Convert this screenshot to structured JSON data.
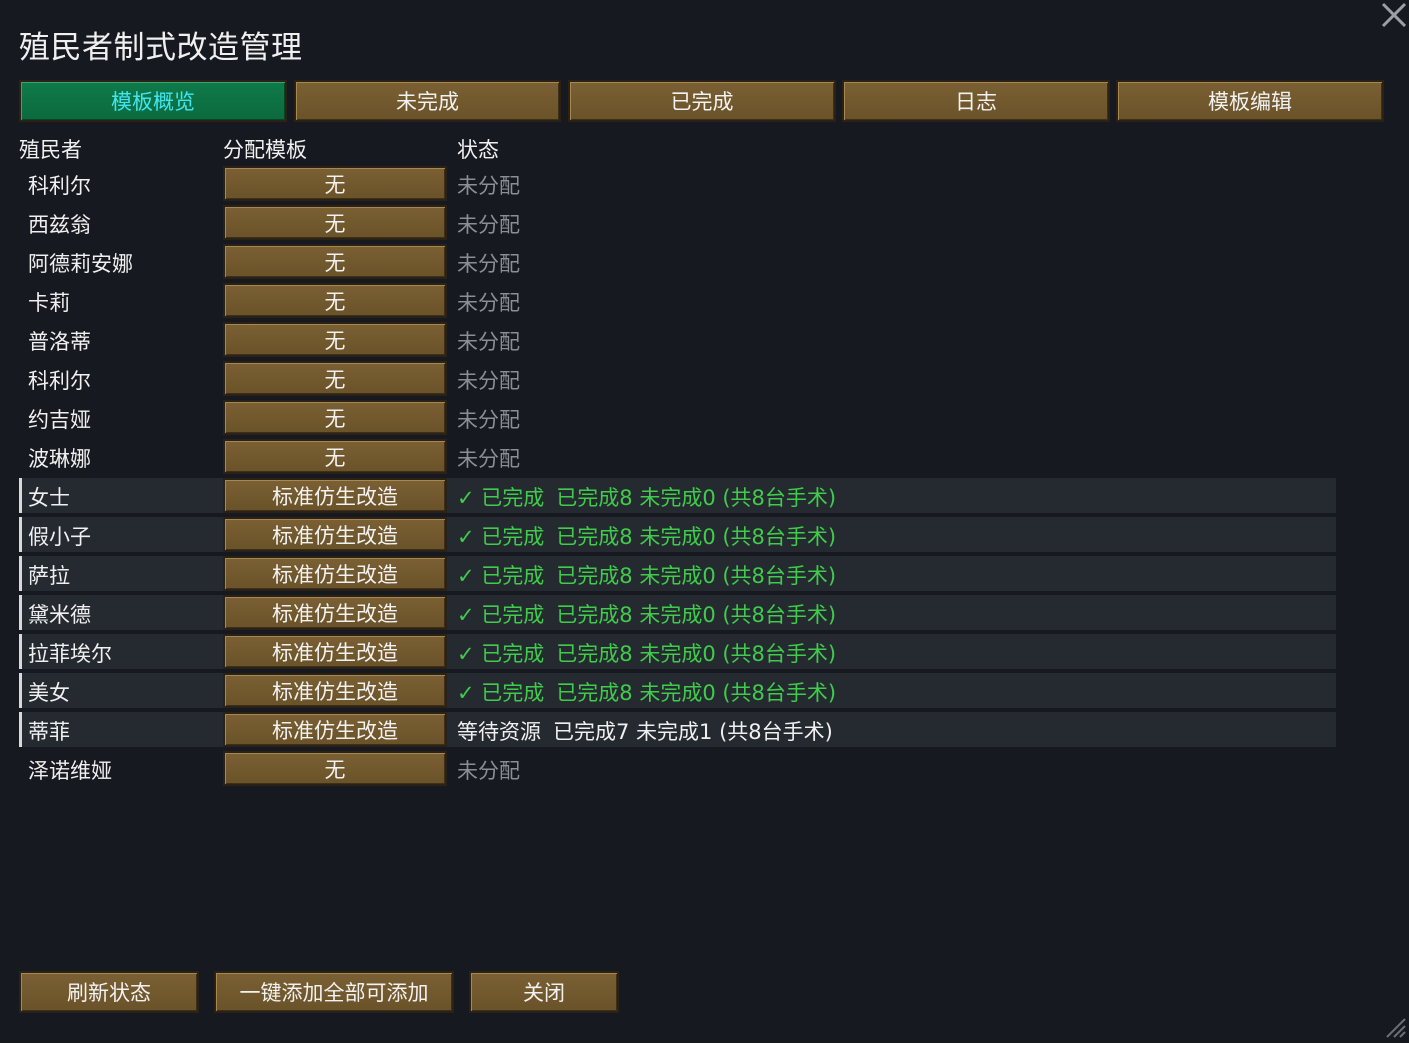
{
  "window": {
    "title": "殖民者制式改造管理"
  },
  "tabs": [
    {
      "label": "模板概览",
      "active": true
    },
    {
      "label": "未完成",
      "active": false
    },
    {
      "label": "已完成",
      "active": false
    },
    {
      "label": "日志",
      "active": false
    },
    {
      "label": "模板编辑",
      "active": false
    }
  ],
  "columns": {
    "colonist": "殖民者",
    "template": "分配模板",
    "status": "状态"
  },
  "rows": [
    {
      "name": "科利尔",
      "template": "无",
      "status": "未分配",
      "detail": "",
      "kind": "unassigned"
    },
    {
      "name": "西兹翁",
      "template": "无",
      "status": "未分配",
      "detail": "",
      "kind": "unassigned"
    },
    {
      "name": "阿德莉安娜",
      "template": "无",
      "status": "未分配",
      "detail": "",
      "kind": "unassigned"
    },
    {
      "name": "卡莉",
      "template": "无",
      "status": "未分配",
      "detail": "",
      "kind": "unassigned"
    },
    {
      "name": "普洛蒂",
      "template": "无",
      "status": "未分配",
      "detail": "",
      "kind": "unassigned"
    },
    {
      "name": "科利尔",
      "template": "无",
      "status": "未分配",
      "detail": "",
      "kind": "unassigned"
    },
    {
      "name": "约吉娅",
      "template": "无",
      "status": "未分配",
      "detail": "",
      "kind": "unassigned"
    },
    {
      "name": "波琳娜",
      "template": "无",
      "status": "未分配",
      "detail": "",
      "kind": "unassigned"
    },
    {
      "name": "女士",
      "template": "标准仿生改造",
      "status": "✓ 已完成",
      "detail": "已完成8 未完成0 (共8台手术)",
      "kind": "done"
    },
    {
      "name": "假小子",
      "template": "标准仿生改造",
      "status": "✓ 已完成",
      "detail": "已完成8 未完成0 (共8台手术)",
      "kind": "done"
    },
    {
      "name": "萨拉",
      "template": "标准仿生改造",
      "status": "✓ 已完成",
      "detail": "已完成8 未完成0 (共8台手术)",
      "kind": "done"
    },
    {
      "name": "黛米德",
      "template": "标准仿生改造",
      "status": "✓ 已完成",
      "detail": "已完成8 未完成0 (共8台手术)",
      "kind": "done"
    },
    {
      "name": "拉菲埃尔",
      "template": "标准仿生改造",
      "status": "✓ 已完成",
      "detail": "已完成8 未完成0 (共8台手术)",
      "kind": "done"
    },
    {
      "name": "美女",
      "template": "标准仿生改造",
      "status": "✓ 已完成",
      "detail": "已完成8 未完成0 (共8台手术)",
      "kind": "done"
    },
    {
      "name": "蒂菲",
      "template": "标准仿生改造",
      "status": "等待资源",
      "detail": "已完成7 未完成1 (共8台手术)",
      "kind": "waiting"
    },
    {
      "name": "泽诺维娅",
      "template": "无",
      "status": "未分配",
      "detail": "",
      "kind": "unassigned"
    }
  ],
  "footer": {
    "refresh_label": "刷新状态",
    "add_all_label": "一键添加全部可添加",
    "close_label": "关闭"
  },
  "colors": {
    "background": "#16191f",
    "button_brown": "#6e552b",
    "tab_active_green": "#0f7a4a",
    "tab_active_text": "#3fe6f2",
    "status_done_green": "#3fcc4a",
    "status_unassigned_gray": "#8a8f96",
    "assigned_row_bg": "#252a31"
  },
  "icons": {
    "close": "close-icon",
    "resize": "resize-grip-icon",
    "check": "check-icon"
  }
}
